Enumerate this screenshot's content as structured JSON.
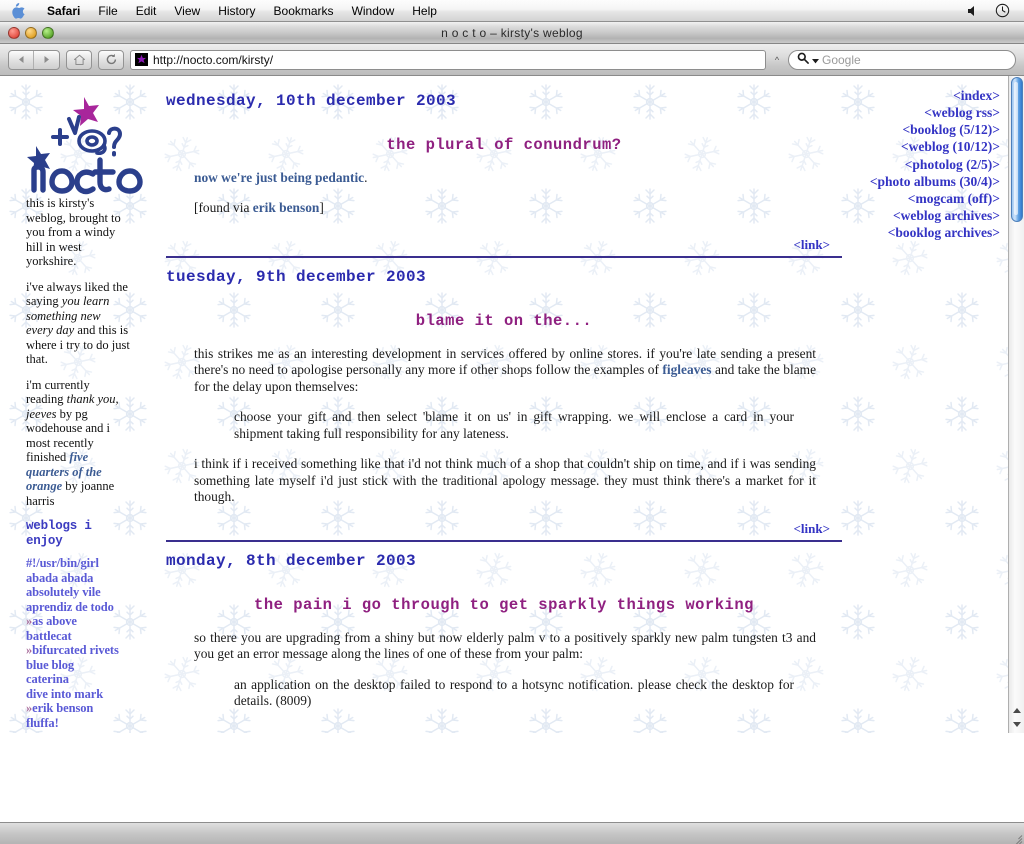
{
  "menubar": {
    "apple_icon": "apple-icon",
    "items": [
      "Safari",
      "File",
      "Edit",
      "View",
      "History",
      "Bookmarks",
      "Window",
      "Help"
    ],
    "right_icons": [
      "volume-icon",
      "clock-icon"
    ]
  },
  "window": {
    "title": "n o c t o – kirsty's weblog",
    "controls": [
      "close-button",
      "minimize-button",
      "zoom-button"
    ]
  },
  "toolbar": {
    "back_icon": "back-arrow-icon",
    "forward_icon": "forward-arrow-icon",
    "home_icon": "home-icon",
    "reload_icon": "reload-icon",
    "favicon": "purple-star-favicon",
    "url": "http://nocto.com/kirsty/",
    "bookmark_chevron": "chevron-icon",
    "search_icon": "search-magnifier-icon",
    "search_placeholder": "Google"
  },
  "sidebar": {
    "logo": {
      "wordmark": "nocto",
      "marks": [
        "magenta-star",
        "caret",
        "plus",
        "blue-star",
        "at-sign",
        "question-mark"
      ]
    },
    "intro": "this is kirsty's weblog, brought to you from a windy hill in west yorkshire.",
    "saying_pre": "i've always liked the saying ",
    "saying_em": "you learn something new every day",
    "saying_post": " and this is where i try to do just that.",
    "reading_pre": "i'm currently reading ",
    "reading_book1": "thank you, jeeves",
    "reading_mid": " by pg wodehouse and i most recently finished ",
    "reading_book2": "five quarters of the orange",
    "reading_post": " by joanne harris",
    "weblogs_heading": "weblogs i enjoy",
    "weblogs": [
      {
        "prefix": "",
        "label": "#!/usr/bin/girl"
      },
      {
        "prefix": "",
        "label": "abada abada"
      },
      {
        "prefix": "",
        "label": "absolutely vile"
      },
      {
        "prefix": "",
        "label": "aprendiz de todo"
      },
      {
        "prefix": "»",
        "label": "as above"
      },
      {
        "prefix": "",
        "label": "battlecat"
      },
      {
        "prefix": "»",
        "label": "bifurcated rivets"
      },
      {
        "prefix": "",
        "label": "blue blog"
      },
      {
        "prefix": "",
        "label": "caterina"
      },
      {
        "prefix": "",
        "label": "dive into mark"
      },
      {
        "prefix": "»",
        "label": "erik benson"
      },
      {
        "prefix": "",
        "label": "fluffa!"
      }
    ]
  },
  "rightnav": {
    "links": [
      "<index>",
      "<weblog rss>",
      "<booklog (5/12)>",
      "<weblog (10/12)>",
      "<photolog (2/5)>",
      "<photo albums (30/4)>",
      "<mogcam (off)>",
      "<weblog archives>",
      "<booklog archives>"
    ]
  },
  "posts": [
    {
      "date": "wednesday, 10th december 2003",
      "title": "the plural of conundrum?",
      "lead_link": "now we're just being pedantic",
      "lead_tail": ".",
      "found_pre": "[found via ",
      "found_link": "erik benson",
      "found_post": "]",
      "permalink": "<link>"
    },
    {
      "date": "tuesday, 9th december 2003",
      "title": "blame it on the...",
      "para1_a": "this strikes me as an interesting development in services offered by online stores. if you're late sending a present there's no need to apologise personally any more if other shops follow the examples of ",
      "para1_link": "figleaves",
      "para1_b": " and take the blame for the delay upon themselves:",
      "quote": "choose your gift and then select 'blame it on us' in gift wrapping. we will enclose a card in your shipment taking full responsibility for any lateness.",
      "para2": "i think if i received something like that i'd not think much of a shop that couldn't ship on time, and if i was sending something late myself i'd just stick with the traditional apology message. they must think there's a market for it though.",
      "permalink": "<link>"
    },
    {
      "date": "monday, 8th december 2003",
      "title": "the pain i go through to get sparkly things working",
      "para1": "so there you are upgrading from a shiny but now elderly palm v to a positively sparkly new palm tungsten t3 and you get an error message along the lines of one of these from your palm:",
      "quote": "an application on the desktop failed to respond to a hotsync notification. please check the desktop for details. (8009)"
    }
  ],
  "colors": {
    "date_heading": "#2b2bae",
    "post_title": "#8f2080",
    "nav_link": "#3434c4",
    "sidebar_link": "#5a5ad6",
    "body_text": "#1a1a1a",
    "inline_link": "#3b5b93",
    "rule": "#3a2f8e",
    "snowflake": "#dfe6f0",
    "page_background": "#ffffff"
  },
  "scrollbar": {
    "up_arrow": "scroll-up-arrow",
    "down_arrow": "scroll-down-arrow",
    "thumb": "scroll-thumb"
  }
}
